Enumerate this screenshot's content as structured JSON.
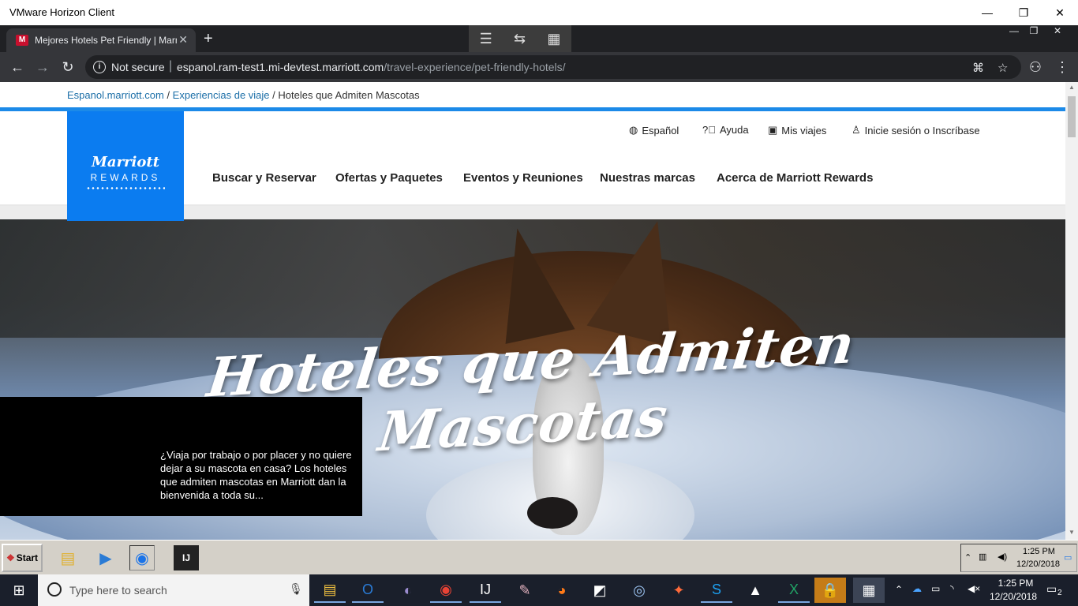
{
  "vmware": {
    "title": "VMware Horizon Client",
    "controls": {
      "minimize": "—",
      "restore": "❐",
      "close": "✕"
    }
  },
  "browser": {
    "tab_title": "Mejores Hotels Pet Friendly | Marriott",
    "tab_close": "✕",
    "new_tab": "+",
    "not_secure": "Not secure",
    "url_host": "espanol.ram-test1.mi-devtest.marriott.com",
    "url_path": "/travel-experience/pet-friendly-hotels/"
  },
  "page": {
    "breadcrumb": {
      "item1": "Espanol.marriott.com",
      "sep1": " / ",
      "item2": "Experiencias de viaje",
      "sep2": " / ",
      "current": "Hoteles que Admiten Mascotas"
    },
    "logo": {
      "brand": "Marriott",
      "sub": "REWARDS"
    },
    "util_nav": {
      "language": "Español",
      "help": "Ayuda",
      "trips": "Mis viajes",
      "signin": "Inicie sesión o Inscríbase"
    },
    "main_nav": {
      "item1": "Buscar y Reservar",
      "item2": "Ofertas y Paquetes",
      "item3": "Eventos y Reuniones",
      "item4": "Nuestras marcas",
      "item5": "Acerca de Marriott Rewards"
    },
    "hero": {
      "title": "Hoteles que Admiten Mascotas",
      "description": "¿Viaja por trabajo o por placer y no quiere dejar a su mascota en casa? Los hoteles que admiten mascotas en Marriott dan la bienvenida a toda su..."
    }
  },
  "inner_taskbar": {
    "start_label": "Start",
    "time": "1:25 PM",
    "date": "12/20/2018"
  },
  "win_taskbar": {
    "search_placeholder": "Type here to search",
    "time": "1:25 PM",
    "date": "12/20/2018",
    "notifications": "2"
  }
}
